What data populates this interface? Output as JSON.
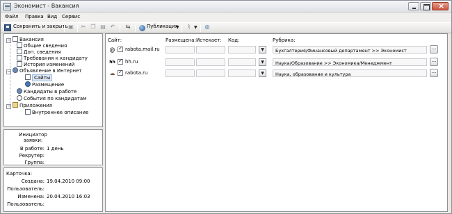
{
  "window": {
    "title": "Экономист - Вакансия"
  },
  "menu": [
    "Файл",
    "Правка",
    "Вид",
    "Сервис"
  ],
  "toolbar": {
    "save_label": "Сохранить и закрыть",
    "publish_label": "Публикация"
  },
  "tree": {
    "root": "Вакансия",
    "children": [
      "Общие сведения",
      "Доп. сведения",
      "Требования к кандидату",
      "История изменений"
    ],
    "internet": "Объявление в Интернет",
    "internet_children": [
      "Сайты",
      "Размещение"
    ],
    "candidates": "Кандидаты в работе",
    "events": "События по кандидатам",
    "attachments": "Приложения",
    "attachment_children": [
      "Внутреннее описание"
    ]
  },
  "info": {
    "initiator_label": "Инициатор заявки:",
    "in_work_label": "В работе:",
    "in_work_value": "1 день",
    "recruiter_label": "Рекрутер:",
    "group_label": "Группа:"
  },
  "card": {
    "title": "Карточка:",
    "created_label": "Создана:",
    "created_value": "19.04.2010 09:00",
    "user1_label": "Пользователь:",
    "changed_label": "Изменена:",
    "changed_value": "20.04.2010 16:03",
    "user2_label": "Пользователь:"
  },
  "sites_table": {
    "headers": {
      "site": "Сайт:",
      "posted": "Размещена:",
      "expires": "Истекает:",
      "code": "Код:",
      "rubric": "Рубрика:"
    },
    "rows": [
      {
        "icon": "@",
        "site": "rabota.mail.ru",
        "rubric": "Бухгалтерия/Финансовый департамент >> Экономист"
      },
      {
        "icon": "hh",
        "site": "hh.ru",
        "rubric": "Наука/Образование >> Экономика/Менеджмент"
      },
      {
        "icon": "☁",
        "site": "rabota.ru",
        "rubric": "Наука, образование и культура"
      }
    ]
  }
}
